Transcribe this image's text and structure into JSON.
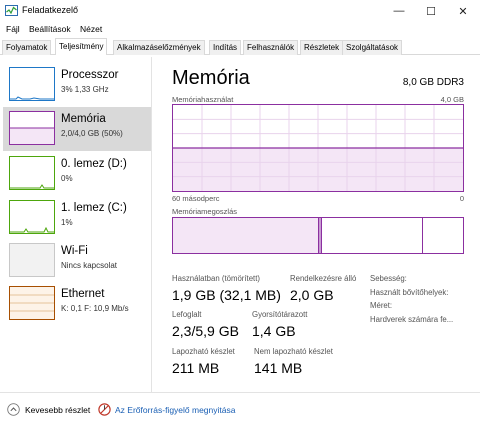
{
  "window": {
    "title": "Feladatkezelő",
    "controls": {
      "minimize": "—",
      "maximize": "☐",
      "close": "✕"
    }
  },
  "menu": [
    "Fájl",
    "Beállítások",
    "Nézet"
  ],
  "tabs": [
    "Folyamatok",
    "Teljesítmény",
    "Alkalmazáselőzmények",
    "Indítás",
    "Felhasználók",
    "Részletek",
    "Szolgáltatások"
  ],
  "sidebar": {
    "items": [
      {
        "title": "Processzor",
        "subtitle": "3% 1,33 GHz",
        "color": "#1e77c7"
      },
      {
        "title": "Memória",
        "subtitle": "2,0/4,0 GB (50%)",
        "color": "#8b2fa0"
      },
      {
        "title": "0. lemez (D:)",
        "subtitle": "0%",
        "color": "#4da60c"
      },
      {
        "title": "1. lemez (C:)",
        "subtitle": "1%",
        "color": "#4da60c"
      },
      {
        "title": "Wi-Fi",
        "subtitle": "Nincs kapcsolat",
        "color": "#a0a0a0"
      },
      {
        "title": "Ethernet",
        "subtitle": "K: 0,1 F: 10,9 Mb/s",
        "color": "#a74f01"
      }
    ]
  },
  "main": {
    "title": "Memória",
    "spec": "8,0 GB DDR3",
    "usage_graph": {
      "label": "Memóriahasználat",
      "max_label": "4,0 GB",
      "time_label": "60 másodperc",
      "min_label": "0",
      "fill_fraction": 0.5
    },
    "composition": {
      "label": "Memóriamegoszlás",
      "segments": [
        {
          "fraction": 0.5,
          "fill": "#f4e6f6"
        },
        {
          "fraction": 0.01,
          "fill": "#c89bd2"
        },
        {
          "fraction": 0.35,
          "fill": "#ffffff"
        },
        {
          "fraction": 0.14,
          "fill": "#ffffff"
        }
      ]
    },
    "stats": {
      "in_use_label": "Használatban (tömörített)",
      "in_use_value": "1,9 GB (32,1 MB)",
      "available_label": "Rendelkezésre álló",
      "available_value": "2,0 GB",
      "committed_label": "Lefoglalt",
      "committed_value": "2,3/5,9 GB",
      "cached_label": "Gyorsítótárazott",
      "cached_value": "1,4 GB",
      "paged_label": "Lapozható készlet",
      "paged_value": "211 MB",
      "nonpaged_label": "Nem lapozható készlet",
      "nonpaged_value": "141 MB"
    },
    "info": {
      "speed_label": "Sebesség:",
      "slots_label": "Használt bővítőhelyek:",
      "form_label": "Méret:",
      "reserved_label": "Hardverek számára fe..."
    }
  },
  "footer": {
    "fewer_details": "Kevesebb részlet",
    "resource_monitor": "Az Erőforrás-figyelő megnyitása"
  }
}
